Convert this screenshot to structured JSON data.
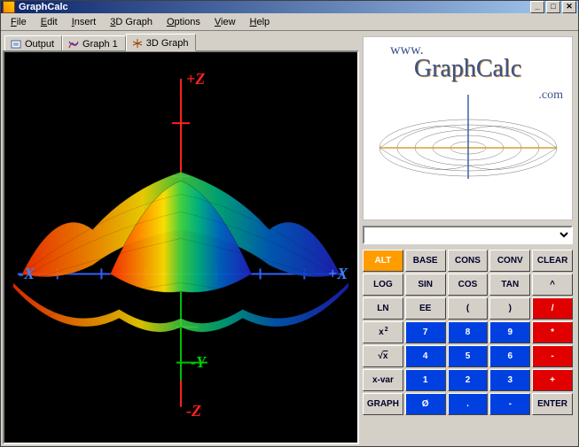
{
  "window": {
    "title": "GraphCalc"
  },
  "menus": [
    "File",
    "Edit",
    "Insert",
    "3D Graph",
    "Options",
    "View",
    "Help"
  ],
  "menus_accel": [
    0,
    0,
    0,
    0,
    0,
    0,
    0
  ],
  "tabs": [
    {
      "label": "Output",
      "icon": "output-icon"
    },
    {
      "label": "Graph 1",
      "icon": "graph2d-icon"
    },
    {
      "label": "3D Graph",
      "icon": "graph3d-icon",
      "active": true
    }
  ],
  "graph3d": {
    "axis_labels": {
      "pos_z": "+Z",
      "neg_z": "-Z",
      "pos_x": "+X",
      "neg_x": "-X",
      "neg_y": "-Y"
    }
  },
  "logo": {
    "line1": "www.",
    "line2": "GraphCalc",
    "line3": ".com"
  },
  "input_value": "",
  "keypad": [
    [
      {
        "label": "ALT",
        "style": "orange",
        "name": "alt-key"
      },
      {
        "label": "BASE",
        "style": "",
        "name": "base-key"
      },
      {
        "label": "CONS",
        "style": "",
        "name": "cons-key"
      },
      {
        "label": "CONV",
        "style": "",
        "name": "conv-key"
      },
      {
        "label": "CLEAR",
        "style": "",
        "name": "clear-key"
      }
    ],
    [
      {
        "label": "LOG",
        "style": "",
        "name": "log-key"
      },
      {
        "label": "SIN",
        "style": "",
        "name": "sin-key"
      },
      {
        "label": "COS",
        "style": "",
        "name": "cos-key"
      },
      {
        "label": "TAN",
        "style": "",
        "name": "tan-key"
      },
      {
        "label": "^",
        "style": "",
        "name": "power-key"
      }
    ],
    [
      {
        "label": "LN",
        "style": "",
        "name": "ln-key"
      },
      {
        "label": "EE",
        "style": "",
        "name": "ee-key"
      },
      {
        "label": "(",
        "style": "",
        "name": "lparen-key"
      },
      {
        "label": ")",
        "style": "",
        "name": "rparen-key"
      },
      {
        "label": "/",
        "style": "red",
        "name": "divide-key"
      }
    ],
    [
      {
        "label": "x²",
        "style": "",
        "name": "square-key",
        "html": "x<sup>2</sup>"
      },
      {
        "label": "7",
        "style": "blue",
        "name": "7-key"
      },
      {
        "label": "8",
        "style": "blue",
        "name": "8-key"
      },
      {
        "label": "9",
        "style": "blue",
        "name": "9-key"
      },
      {
        "label": "*",
        "style": "red",
        "name": "multiply-key"
      }
    ],
    [
      {
        "label": "√x",
        "style": "",
        "name": "sqrt-key",
        "html": "√<span style='text-decoration:overline'>x</span>"
      },
      {
        "label": "4",
        "style": "blue",
        "name": "4-key"
      },
      {
        "label": "5",
        "style": "blue",
        "name": "5-key"
      },
      {
        "label": "6",
        "style": "blue",
        "name": "6-key"
      },
      {
        "label": "-",
        "style": "red",
        "name": "minus-key"
      }
    ],
    [
      {
        "label": "x-var",
        "style": "",
        "name": "xvar-key"
      },
      {
        "label": "1",
        "style": "blue",
        "name": "1-key"
      },
      {
        "label": "2",
        "style": "blue",
        "name": "2-key"
      },
      {
        "label": "3",
        "style": "blue",
        "name": "3-key"
      },
      {
        "label": "+",
        "style": "red",
        "name": "plus-key"
      }
    ],
    [
      {
        "label": "GRAPH",
        "style": "",
        "name": "graph-key"
      },
      {
        "label": "Ø",
        "style": "blue",
        "name": "zero-key"
      },
      {
        "label": ".",
        "style": "blue",
        "name": "dot-key"
      },
      {
        "label": "-",
        "style": "blue",
        "name": "neg-key"
      },
      {
        "label": "ENTER",
        "style": "",
        "name": "enter-key"
      }
    ]
  ],
  "chart_data": {
    "type": "surface-3d",
    "function": "sin(sqrt(x^2+y^2))",
    "x_range": [
      -8,
      8
    ],
    "y_range": [
      -8,
      8
    ],
    "z_range": [
      -1,
      1
    ],
    "title": "3D Graph",
    "colormap": "rainbow (red→yellow→green→blue by x),",
    "axes": {
      "x": "blue",
      "y": "green",
      "z": "red"
    },
    "background": "#000000"
  }
}
